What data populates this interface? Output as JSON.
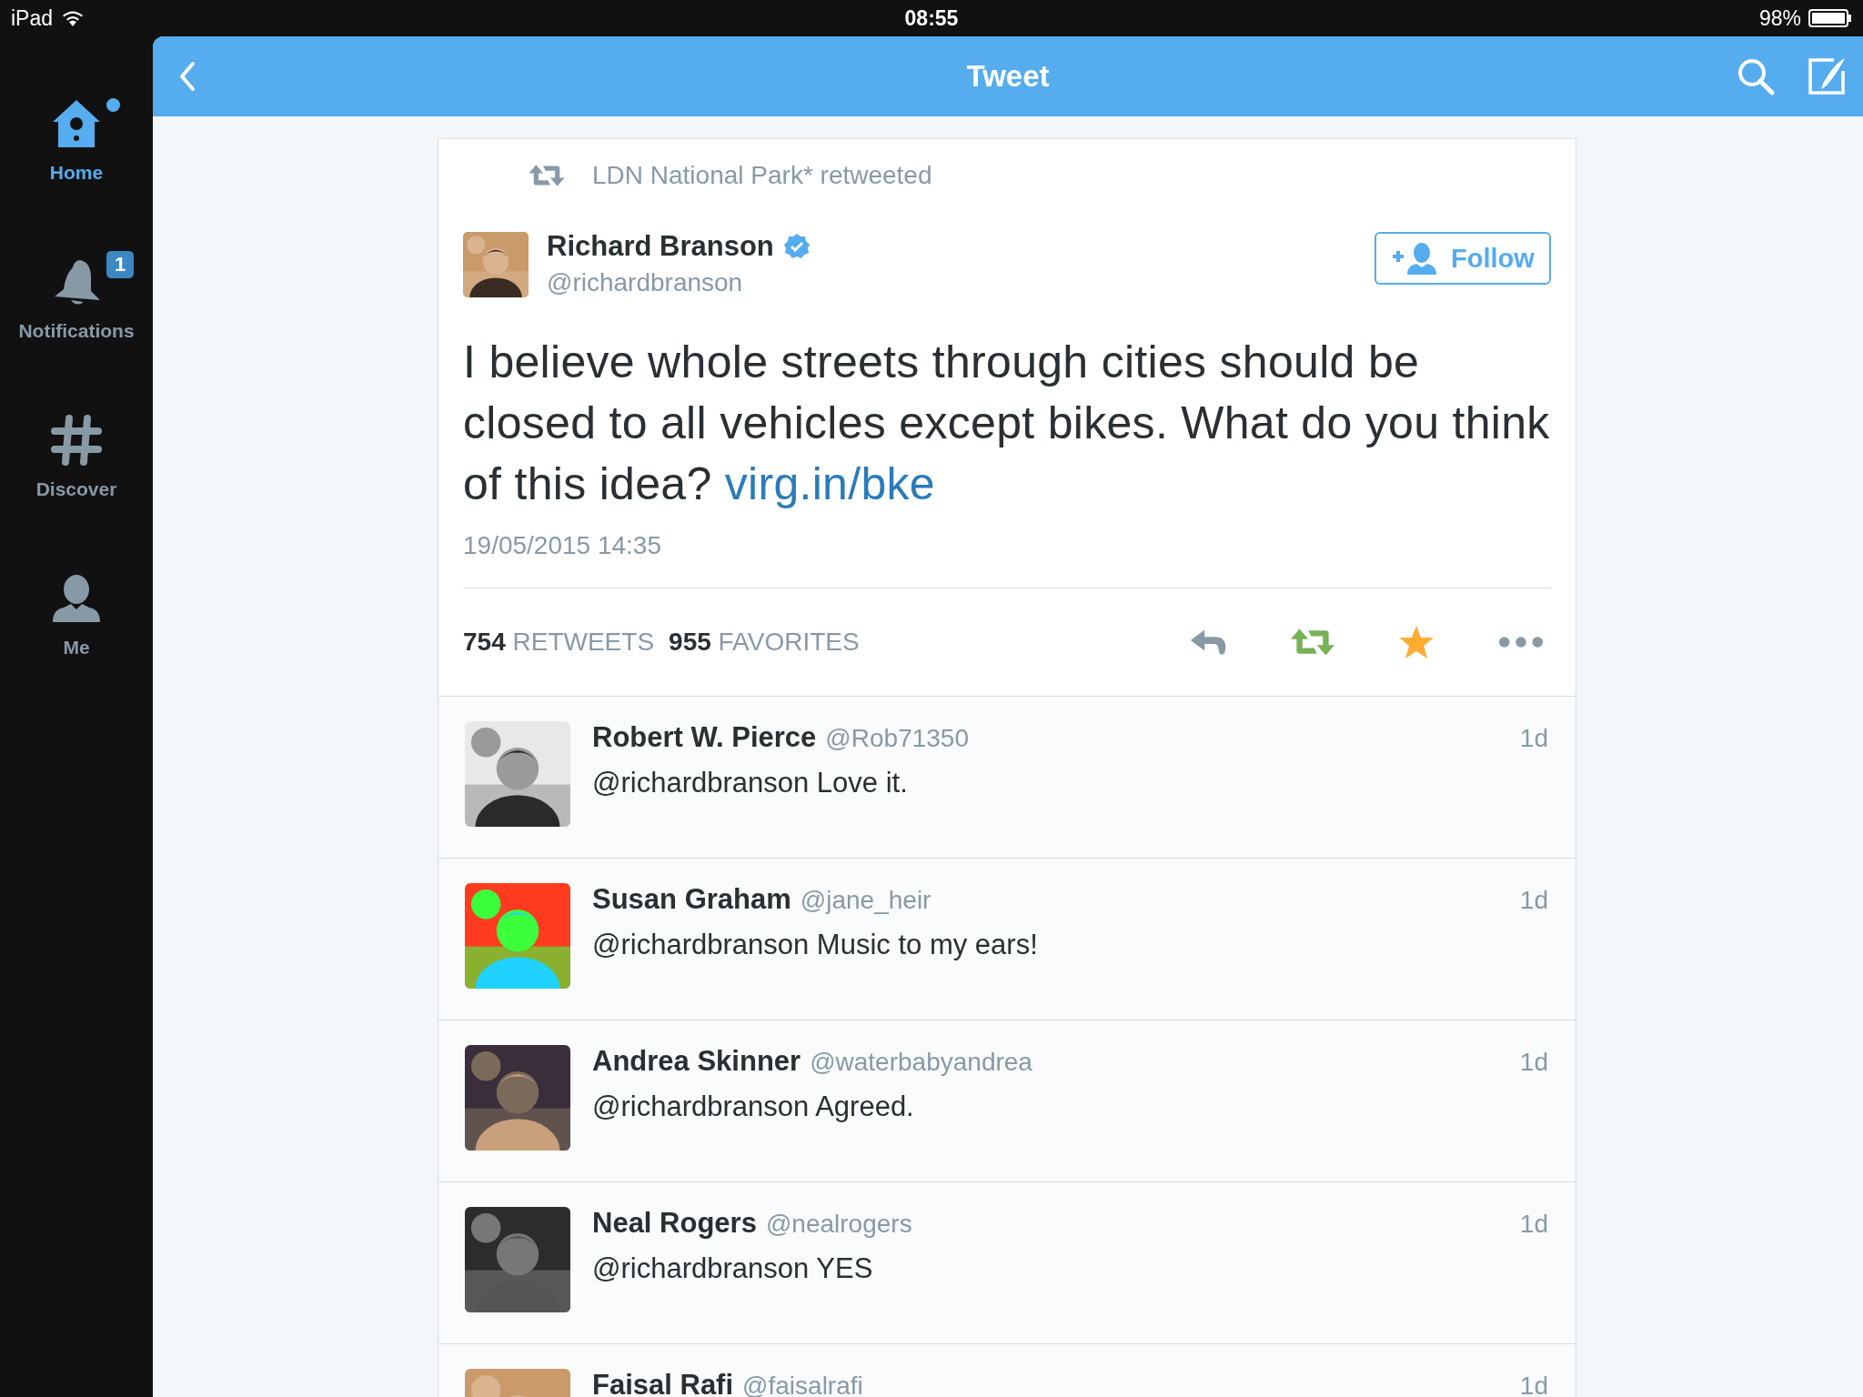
{
  "status_bar": {
    "carrier": "iPad",
    "time": "08:55",
    "battery": "98%"
  },
  "sidebar": {
    "items": [
      {
        "kind": "home",
        "label": "Home",
        "selected": true,
        "dot": true
      },
      {
        "kind": "notifications",
        "label": "Notifications",
        "selected": false,
        "dot": false,
        "badge": "1"
      },
      {
        "kind": "discover",
        "label": "Discover",
        "selected": false,
        "dot": false
      },
      {
        "kind": "me",
        "label": "Me",
        "selected": false,
        "dot": false
      }
    ]
  },
  "header": {
    "title": "Tweet"
  },
  "tweet": {
    "retweeted_by": "LDN National Park* retweeted",
    "author": {
      "name": "Richard Branson",
      "handle": "@richardbranson",
      "verified": true
    },
    "follow_button": "Follow",
    "text": "I believe whole streets through cities should be closed to all vehicles except bikes. What do you think of this idea?",
    "link": "virg.in/bke",
    "timestamp": "19/05/2015 14:35",
    "stats": [
      {
        "count": "754",
        "label": "RETWEETS"
      },
      {
        "count": "955",
        "label": "FAVORITES"
      }
    ],
    "actions": [
      {
        "kind": "reply",
        "active": false
      },
      {
        "kind": "retweet",
        "active": true
      },
      {
        "kind": "favorite",
        "active": true
      },
      {
        "kind": "more",
        "active": false
      }
    ]
  },
  "replies": [
    {
      "name": "Robert W. Pierce",
      "handle": "@Rob71350",
      "text": "@richardbranson Love it.",
      "time": "1d"
    },
    {
      "name": "Susan Graham",
      "handle": "@jane_heir",
      "text": "@richardbranson Music to my ears!",
      "time": "1d"
    },
    {
      "name": "Andrea Skinner",
      "handle": "@waterbabyandrea",
      "text": "@richardbranson Agreed.",
      "time": "1d"
    },
    {
      "name": "Neal Rogers",
      "handle": "@nealrogers",
      "text": "@richardbranson YES",
      "time": "1d"
    },
    {
      "name": "Faisal Rafi",
      "handle": "@faisalrafi",
      "time": "1d"
    }
  ]
}
